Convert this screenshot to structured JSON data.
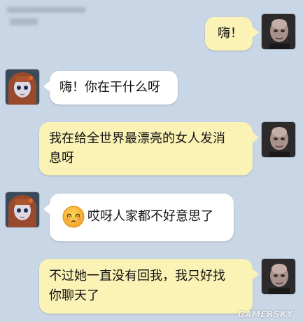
{
  "messages": [
    {
      "side": "right",
      "text": "嗨！"
    },
    {
      "side": "left",
      "text": "嗨！你在干什么呀"
    },
    {
      "side": "right",
      "text_line1": "我在给全世界最漂亮的女人发消",
      "text_line2": "息呀"
    },
    {
      "side": "left",
      "text": "哎呀人家都不好意思了",
      "emoji": "shy-face-emoji"
    },
    {
      "side": "right",
      "text_line1": "不过她一直没有回我，我只好找",
      "text_line2": "你聊天了"
    }
  ],
  "watermark": "GAMERSKY",
  "colors": {
    "background": "#c9d6e6",
    "sent_bubble": "#fbf3b5",
    "received_bubble": "#ffffff"
  }
}
